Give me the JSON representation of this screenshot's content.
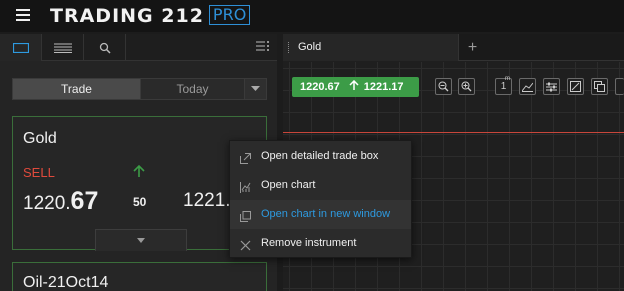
{
  "header": {
    "logo_text": "TRADING 212",
    "logo_badge": "PRO",
    "menu_icon": "hamburger-icon"
  },
  "watchlist": {
    "tab_icons": [
      "card-view-icon",
      "list-view-icon",
      "search-icon",
      "more-menu-icon"
    ],
    "segment": {
      "trade_label": "Trade",
      "today_label": "Today",
      "dropdown_icon": "chevron-down-icon"
    },
    "instruments": [
      {
        "name": "Gold",
        "sell_label": "SELL",
        "bid_main": "1220.",
        "bid_big": "67",
        "spread": "50",
        "ask": "1221.",
        "direction_icon": "arrow-up-icon"
      },
      {
        "name": "Oil-21Oct14"
      }
    ]
  },
  "chart_panel": {
    "tab_label": "Gold",
    "add_tab_icon": "plus-icon",
    "quote": {
      "bid": "1220.67",
      "ask": "1221.17",
      "direction_icon": "arrow-up-icon"
    },
    "toolbar": {
      "zoom_out_icon": "zoom-out-icon",
      "zoom_in_icon": "zoom-in-icon",
      "period_label": "1",
      "period_suffix": "m",
      "tool_icons": [
        "chart-type-icon",
        "indicators-icon",
        "drawing-icon",
        "layers-icon",
        "screenshot-icon"
      ]
    }
  },
  "context_menu": {
    "items": [
      {
        "label": "Open detailed trade box",
        "icon": "trade-box-icon"
      },
      {
        "label": "Open chart",
        "icon": "chart-icon"
      },
      {
        "label": "Open chart in new window",
        "icon": "new-window-icon"
      },
      {
        "label": "Remove instrument",
        "icon": "close-icon"
      }
    ]
  },
  "colors": {
    "accent_green": "#3c9c47",
    "sell_red": "#e04a3c",
    "link_blue": "#2e9ae0",
    "card_border": "#3a6e3a"
  }
}
